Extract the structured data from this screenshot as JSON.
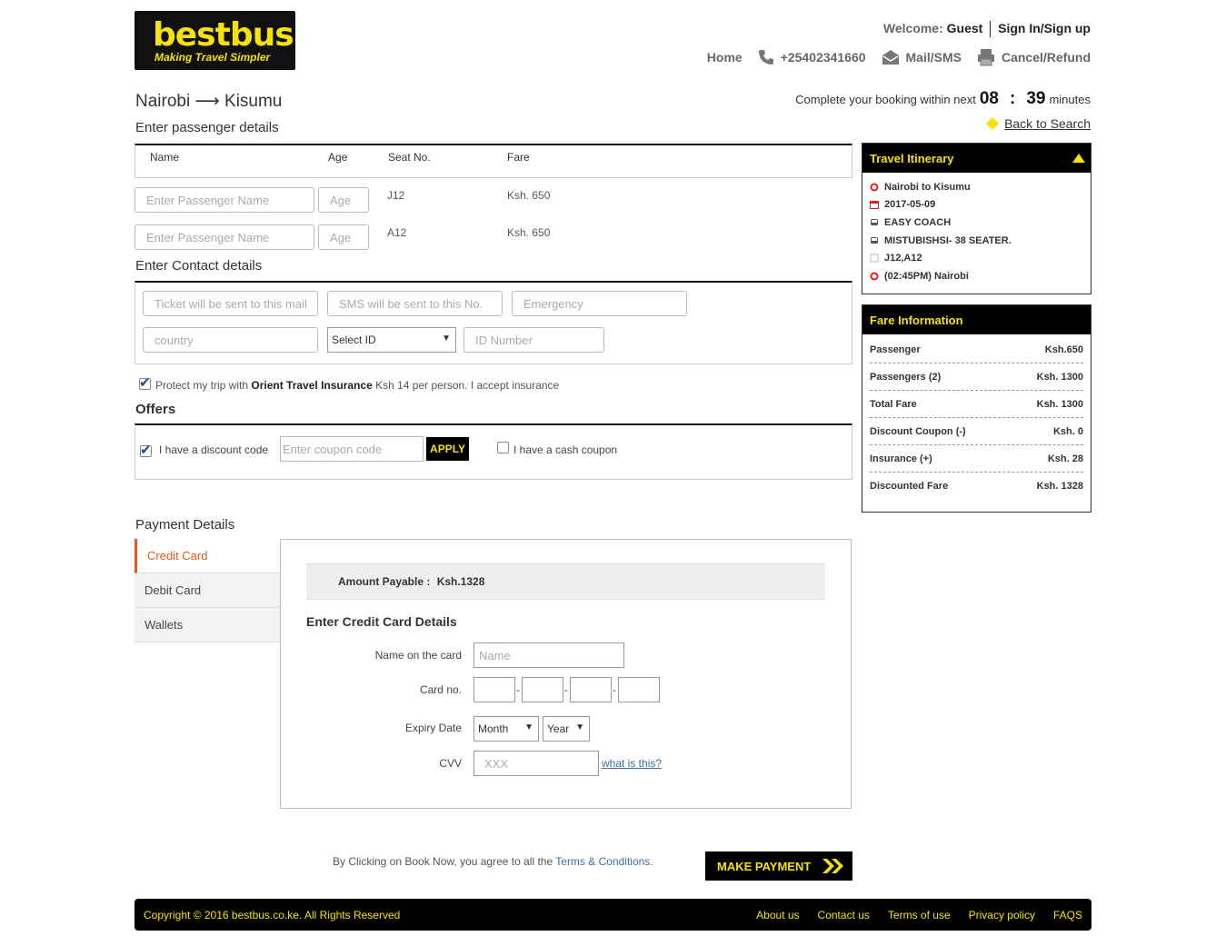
{
  "header": {
    "brand": "bestbus",
    "tagline": "Making Travel Simpler",
    "welcome_label": "Welcome:",
    "user": "Guest",
    "signin": "Sign In/Sign up",
    "nav": {
      "home": "Home",
      "phone": "+25402341660",
      "mail": "Mail/SMS",
      "cancel": "Cancel/Refund"
    }
  },
  "trip": {
    "from": "Nairobi",
    "arrow": "⟶",
    "to": "Kisumu",
    "timer_text": "Complete your booking within next",
    "minutes_left": "08",
    "colon": ":",
    "seconds_left": "39",
    "minutes_label": "minutes",
    "back_link": "Back to Search"
  },
  "passengers": {
    "title": "Enter passenger details",
    "columns": [
      "Name",
      "Age",
      "Seat No.",
      "Fare"
    ],
    "name_placeholder": "Enter Passenger Name",
    "age_placeholder": "Age",
    "rows": [
      {
        "seat": "J12",
        "fare": "Ksh. 650"
      },
      {
        "seat": "A12",
        "fare": "Ksh. 650"
      }
    ]
  },
  "contact": {
    "title": "Enter Contact details",
    "email_placeholder": "Ticket will be sent to this mail",
    "sms_placeholder": "SMS will be sent to this No.",
    "emergency_placeholder": "Emergency",
    "country_placeholder": "country",
    "id_select": "Select ID",
    "id_placeholder": "ID Number"
  },
  "insurance": {
    "prefix": "Protect my trip with",
    "provider": "Orient Travel Insurance",
    "suffix": "Ksh 14 per person. I accept insurance",
    "checked": true
  },
  "offers": {
    "title": "Offers",
    "discount_label": "I have a discount code",
    "discount_checked": true,
    "coupon_placeholder": "Enter coupon code",
    "apply": "APPLY",
    "cash_label": "I have a cash coupon",
    "cash_checked": false
  },
  "itinerary": {
    "title": "Travel Itinerary",
    "rows": [
      "Nairobi to Kisumu",
      "2017-05-09",
      "EASY COACH",
      "MISTUBISHSI- 38 SEATER.",
      "J12,A12",
      "(02:45PM) Nairobi"
    ]
  },
  "fare": {
    "title": "Fare Information",
    "rows": [
      {
        "label": "Passenger",
        "value": "Ksh.650"
      },
      {
        "label": "Passengers (2)",
        "value": "Ksh. 1300"
      },
      {
        "label": "Total Fare",
        "value": "Ksh. 1300"
      },
      {
        "label": "Discount Coupon (-)",
        "value": "Ksh. 0"
      },
      {
        "label": "Insurance (+)",
        "value": "Ksh. 28"
      },
      {
        "label": "Discounted Fare",
        "value": "Ksh. 1328"
      }
    ]
  },
  "payment": {
    "title": "Payment Details",
    "tabs": [
      "Credit Card",
      "Debit Card",
      "Wallets"
    ],
    "amount_label": "Amount Payable :",
    "amount_value": "Ksh.1328",
    "form_title": "Enter Credit Card Details",
    "name_label": "Name on the card",
    "name_placeholder": "Name",
    "card_label": "Card no.",
    "expiry_label": "Expiry Date",
    "month": "Month",
    "year": "Year",
    "cvv_label": "CVV",
    "cvv_placeholder": "XXX",
    "cvv_help": "what is this?"
  },
  "agreement": {
    "text": "By Clicking on Book Now, you agree to all the",
    "link": "Terms & Conditions",
    "period": "."
  },
  "make_payment": "MAKE PAYMENT",
  "footer": {
    "copyright": "Copyright © 2016 bestbus.co.ke. All Rights Reserved",
    "links": [
      "About us",
      "Contact us",
      "Terms of use",
      "Privacy policy",
      "FAQS"
    ]
  },
  "colors": {
    "brand_yellow": "#f5e20a",
    "black": "#000000",
    "accent_orange": "#e05a1e",
    "link_blue": "#3a6ea5"
  }
}
